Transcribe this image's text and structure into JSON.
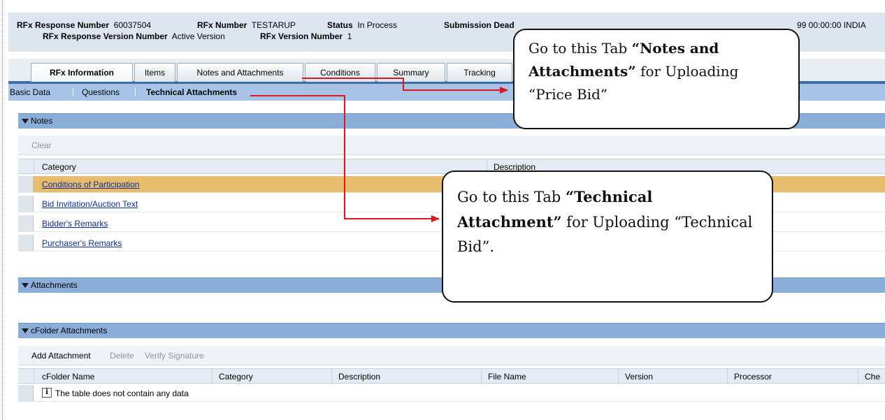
{
  "header": {
    "rfx_response_number_label": "RFx Response Number",
    "rfx_response_number_value": "60037504",
    "rfx_number_label": "RFx Number",
    "rfx_number_value": "TESTARUP",
    "status_label": "Status",
    "status_value": "In Process",
    "submission_deadline_label": "Submission Dead",
    "end_date_fragment": "99 00:00:00 INDIA",
    "rfx_response_version_label": "RFx Response Version Number",
    "rfx_response_version_value": "Active Version",
    "rfx_version_label": "RFx Version Number",
    "rfx_version_value": "1"
  },
  "tabs": [
    {
      "label": "RFx Information",
      "active": true
    },
    {
      "label": "Items",
      "active": false
    },
    {
      "label": "Notes and Attachments",
      "active": false
    },
    {
      "label": "Conditions",
      "active": false
    },
    {
      "label": "Summary",
      "active": false
    },
    {
      "label": "Tracking",
      "active": false
    }
  ],
  "subnav": [
    {
      "label": "Basic Data",
      "active": false
    },
    {
      "label": "Questions",
      "active": false
    },
    {
      "label": "Technical Attachments",
      "active": true
    }
  ],
  "notes": {
    "title": "Notes",
    "toolbar_clear": "Clear",
    "columns": [
      "Category",
      "Description"
    ],
    "rows": [
      {
        "label": "Conditions of Participation",
        "selected": true
      },
      {
        "label": "Bid Invitation/Auction Text",
        "selected": false
      },
      {
        "label": "Bidder's Remarks",
        "selected": false
      },
      {
        "label": "Purchaser's Remarks",
        "selected": false
      }
    ]
  },
  "attachments": {
    "title": "Attachments"
  },
  "cfolder": {
    "title": "cFolder Attachments",
    "toolbar": {
      "add": "Add Attachment",
      "delete": "Delete",
      "verify": "Verify Signature"
    },
    "columns": [
      "cFolder Name",
      "Category",
      "Description",
      "File Name",
      "Version",
      "Processor",
      "Che"
    ],
    "empty_text": "The table does not contain any data",
    "empty_icon": "info-icon"
  },
  "callouts": {
    "notes_tab": {
      "prefix": "Go to this Tab ",
      "bold": "“Notes and Attachments”",
      "suffix": " for Uploading “Price Bid”"
    },
    "technical_tab": {
      "prefix": "Go to this Tab ",
      "bold": "“Technical Attachment”",
      "suffix": " for Uploading “Technical Bid”."
    }
  },
  "colors": {
    "header_bg": "#dde6ef",
    "subnav_bg": "#a7c3e6",
    "panel_bar": "#8aaed9",
    "selected_row": "#e8bc6d",
    "link": "#0b2e97",
    "arrow": "#e0141b"
  }
}
